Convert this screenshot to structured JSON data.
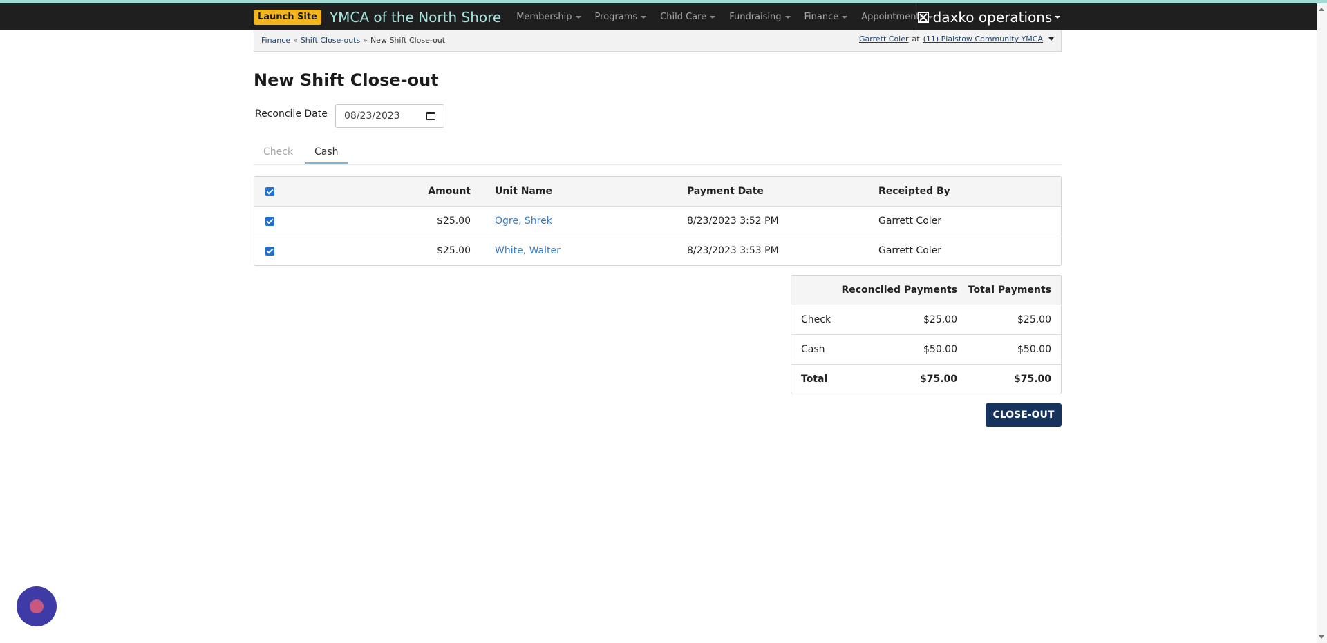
{
  "header": {
    "launch_label": "Launch Site",
    "brand": "YMCA of the North Shore",
    "nav": [
      "Membership",
      "Programs",
      "Child Care",
      "Fundraising",
      "Finance",
      "Appointments"
    ],
    "product": "daxko operations"
  },
  "breadcrumb": {
    "items": [
      "Finance",
      "Shift Close-outs"
    ],
    "current": "New Shift Close-out",
    "separator": "»"
  },
  "user": {
    "name": "Garrett Coler",
    "at": "at",
    "location": "(11) Plaistow Community YMCA"
  },
  "page": {
    "title": "New Shift Close-out",
    "reconcile_label": "Reconcile Date",
    "reconcile_value": "08/23/2023"
  },
  "tabs": [
    "Check",
    "Cash"
  ],
  "payments_table": {
    "columns": [
      "Amount",
      "Unit Name",
      "Payment Date",
      "Receipted By"
    ],
    "rows": [
      {
        "checked": true,
        "amount": "$25.00",
        "unit": "Ogre, Shrek",
        "date": "8/23/2023 3:52 PM",
        "by": "Garrett Coler"
      },
      {
        "checked": true,
        "amount": "$25.00",
        "unit": "White, Walter",
        "date": "8/23/2023 3:53 PM",
        "by": "Garrett Coler"
      }
    ]
  },
  "summary": {
    "columns": [
      "Reconciled Payments",
      "Total Payments"
    ],
    "rows": [
      {
        "label": "Check",
        "reconciled": "$25.00",
        "total": "$25.00"
      },
      {
        "label": "Cash",
        "reconciled": "$50.00",
        "total": "$50.00"
      },
      {
        "label": "Total",
        "reconciled": "$75.00",
        "total": "$75.00"
      }
    ]
  },
  "actions": {
    "close_out": "CLOSE-OUT"
  },
  "colors": {
    "accent": "#f3b51b",
    "brand": "#a7e3de",
    "button": "#15335c",
    "link": "#3a7ec4"
  }
}
